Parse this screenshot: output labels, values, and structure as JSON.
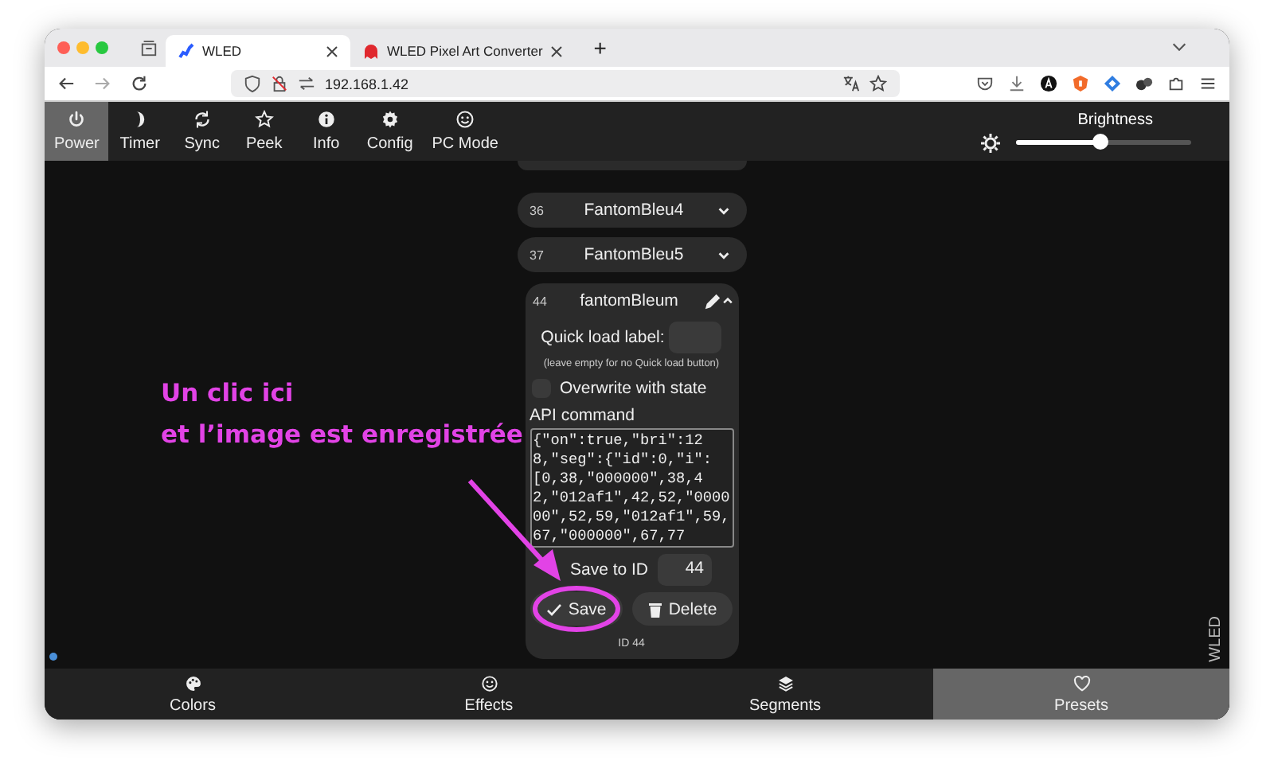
{
  "browser": {
    "tabs": [
      {
        "title": "WLED",
        "selected": true
      },
      {
        "title": "WLED Pixel Art Converter",
        "selected": false
      }
    ],
    "new_tab": "+",
    "address": "192.168.1.42"
  },
  "top_bar": {
    "buttons": [
      {
        "label": "Power",
        "selected": true
      },
      {
        "label": "Timer",
        "selected": false
      },
      {
        "label": "Sync",
        "selected": false
      },
      {
        "label": "Peek",
        "selected": false
      },
      {
        "label": "Info",
        "selected": false
      },
      {
        "label": "Config",
        "selected": false
      },
      {
        "label": "PC Mode",
        "selected": false
      }
    ],
    "brightness": {
      "label": "Brightness",
      "level": 0.48
    }
  },
  "presets": [
    {
      "id": "36",
      "name": "FantomBleu4",
      "expanded": false
    },
    {
      "id": "37",
      "name": "FantomBleu5",
      "expanded": false
    },
    {
      "id": "44",
      "name": "fantomBleum",
      "expanded": true,
      "editor": {
        "quick_load_label": "Quick load label:",
        "quick_load_hint": "(leave empty for no Quick load button)",
        "overwrite": {
          "label": "Overwrite with state",
          "checked": false
        },
        "api_label": "API command",
        "api_command": "{\"on\":true,\"bri\":128,\"seg\":{\"id\":0,\"i\":[0,38,\"000000\",38,42,\"012af1\",42,52,\"000000\",52,59,\"012af1\",59,67,\"000000\",67,77",
        "save_to_id_label": "Save to ID",
        "save_to_id": "44",
        "save": "Save",
        "delete": "Delete",
        "footer": "ID 44"
      }
    }
  ],
  "brand": "WLED",
  "bottom_nav": [
    {
      "label": "Colors",
      "selected": false
    },
    {
      "label": "Effects",
      "selected": false
    },
    {
      "label": "Segments",
      "selected": false
    },
    {
      "label": "Presets",
      "selected": true
    }
  ],
  "annotation": {
    "lines": [
      "Un clic ici",
      "et l’image est enregistrée"
    ]
  }
}
